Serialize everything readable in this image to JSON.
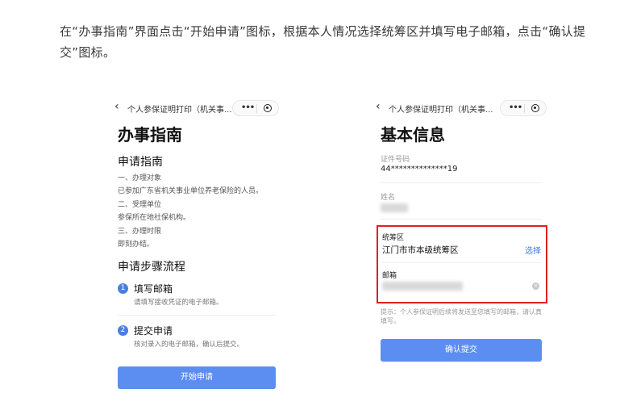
{
  "intro_text": "在“办事指南”界面点击“开始申请”图标，根据本人情况选择统筹区并填写电子邮箱，点击“确认提交”图标。",
  "left_screen": {
    "nav_back_icon": "‹",
    "nav_title": "个人参保证明打印（机关事...",
    "capsule_dots": "•••",
    "page_title": "办事指南",
    "guide_title": "申请指南",
    "guide_lines": [
      "一、办理对象",
      "已参加广东省机关事业单位养老保险的人员。",
      "二、受理单位",
      "参保所在地社保机构。",
      "三、办理时限",
      "即刻办结。"
    ],
    "steps_title": "申请步骤流程",
    "steps": [
      {
        "num": "1",
        "title": "填写邮箱",
        "desc": "请填写接收凭证的电子邮箱。"
      },
      {
        "num": "2",
        "title": "提交申请",
        "desc": "核对录入的电子邮箱，确认后提交。"
      }
    ],
    "start_button": "开始申请"
  },
  "right_screen": {
    "nav_back_icon": "‹",
    "nav_title": "个人参保证明打印（机关事...",
    "capsule_dots": "•••",
    "page_title": "基本信息",
    "id_label": "证件号码",
    "id_value": "44**************19",
    "name_label": "姓名",
    "region_label": "统筹区",
    "region_value": "江门市市本级统筹区",
    "region_select": "选择",
    "email_label": "邮箱",
    "clear_icon": "×",
    "hint": "提示：个人参保证明后续将发送至您填写的邮箱，请认真填写。",
    "confirm_button": "确认提交"
  },
  "colors": {
    "primary_button": "#5b8ef0",
    "link": "#3c7ae0",
    "highlight": "#e02020",
    "step_badge": "#4a7fe0"
  }
}
